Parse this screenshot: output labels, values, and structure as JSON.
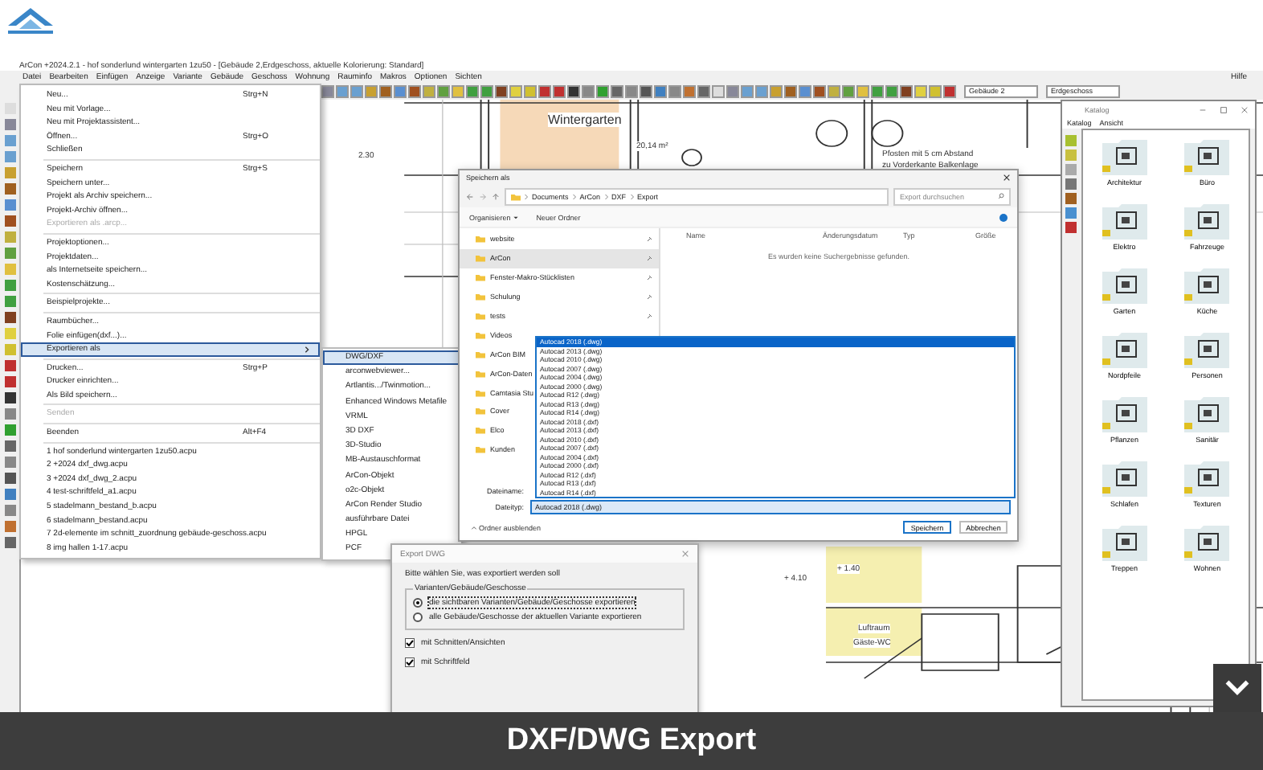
{
  "app": {
    "title": "ArCon +2024.2.1 - hof sonderlund wintergarten 1zu50 - [Gebäude 2,Erdgeschoss, aktuelle Kolorierung: Standard]",
    "menu": [
      "Datei",
      "Bearbeiten",
      "Einfügen",
      "Anzeige",
      "Variante",
      "Gebäude",
      "Geschoss",
      "Wohnung",
      "Rauminfo",
      "Makros",
      "Optionen",
      "Sichten"
    ],
    "help": "Hilfe",
    "building": "Gebäude 2",
    "floor": "Erdgeschoss"
  },
  "drawing": {
    "labels": [
      "Wintergarten",
      "20,14 m²",
      "Pfosten mit 5 cm Abstand",
      "zu Vorderkante Balkenlage",
      "2.30",
      "+ 1.40",
      "+ 4.10",
      "Luftraum",
      "Gäste-WC"
    ]
  },
  "file_menu": {
    "groups": [
      {
        "items": [
          {
            "label": "Neu...",
            "shortcut": "Strg+N",
            "kind": "item",
            "disabled": false,
            "selected": false
          },
          {
            "label": "Neu mit Vorlage...",
            "kind": "item",
            "disabled": false,
            "selected": false
          },
          {
            "label": "Neu mit Projektassistent...",
            "kind": "item",
            "disabled": false,
            "selected": false
          },
          {
            "label": "Öffnen...",
            "shortcut": "Strg+O",
            "kind": "item",
            "disabled": false,
            "selected": false
          },
          {
            "label": "Schließen",
            "kind": "item",
            "disabled": false,
            "selected": false
          }
        ]
      },
      {
        "items": [
          {
            "label": "Speichern",
            "shortcut": "Strg+S",
            "kind": "item",
            "disabled": false,
            "selected": false
          },
          {
            "label": "Speichern unter...",
            "kind": "item",
            "disabled": false,
            "selected": false
          },
          {
            "label": "Projekt als Archiv speichern...",
            "kind": "item",
            "disabled": false,
            "selected": false
          },
          {
            "label": "Projekt-Archiv öffnen...",
            "kind": "item",
            "disabled": false,
            "selected": false
          },
          {
            "label": "Exportieren als .arcp...",
            "kind": "item",
            "disabled": true,
            "selected": false
          }
        ]
      },
      {
        "items": [
          {
            "label": "Projektoptionen...",
            "kind": "item",
            "disabled": false,
            "selected": false
          },
          {
            "label": "Projektdaten...",
            "kind": "item",
            "disabled": false,
            "selected": false
          },
          {
            "label": "als Internetseite speichern...",
            "kind": "item",
            "disabled": false,
            "selected": false
          },
          {
            "label": "Kostenschätzung...",
            "kind": "item",
            "disabled": false,
            "selected": false
          }
        ]
      },
      {
        "items": [
          {
            "label": "Beispielprojekte...",
            "kind": "item",
            "disabled": false,
            "selected": false
          }
        ]
      },
      {
        "items": [
          {
            "label": "Raumbücher...",
            "kind": "item",
            "disabled": false,
            "selected": false
          },
          {
            "label": "Folie einfügen(dxf...)...",
            "kind": "item",
            "disabled": false,
            "selected": false
          },
          {
            "label": "Exportieren als",
            "kind": "submenu",
            "disabled": false,
            "selected": true
          }
        ]
      },
      {
        "items": [
          {
            "label": "Drucken...",
            "shortcut": "Strg+P",
            "kind": "item",
            "disabled": false,
            "selected": false
          },
          {
            "label": "Drucker einrichten...",
            "kind": "item",
            "disabled": false,
            "selected": false
          },
          {
            "label": "Als Bild speichern...",
            "kind": "item",
            "disabled": false,
            "selected": false
          }
        ]
      },
      {
        "items": [
          {
            "label": "Senden",
            "kind": "item",
            "disabled": true,
            "selected": false
          }
        ]
      },
      {
        "items": [
          {
            "label": "Beenden",
            "shortcut": "Alt+F4",
            "kind": "item",
            "disabled": false,
            "selected": false
          }
        ]
      },
      {
        "items": [
          {
            "label": "1 hof sonderlund wintergarten 1zu50.acpu",
            "kind": "item",
            "disabled": false,
            "selected": false
          },
          {
            "label": "2 +2024 dxf_dwg.acpu",
            "kind": "item",
            "disabled": false,
            "selected": false
          },
          {
            "label": "3 +2024 dxf_dwg_2.acpu",
            "kind": "item",
            "disabled": false,
            "selected": false
          },
          {
            "label": "4 test-schriftfeld_a1.acpu",
            "kind": "item",
            "disabled": false,
            "selected": false
          },
          {
            "label": "5 stadelmann_bestand_b.acpu",
            "kind": "item",
            "disabled": false,
            "selected": false
          },
          {
            "label": "6 stadelmann_bestand.acpu",
            "kind": "item",
            "disabled": false,
            "selected": false
          },
          {
            "label": "7 2d-elemente im schnitt_zuordnung gebäude-geschoss.acpu",
            "kind": "item",
            "disabled": false,
            "selected": false
          },
          {
            "label": "8 img hallen 1-17.acpu",
            "kind": "item",
            "disabled": false,
            "selected": false
          }
        ]
      }
    ]
  },
  "export_submenu": {
    "items": [
      {
        "label": "DWG/DXF",
        "selected": true
      },
      {
        "label": "arconwebviewer...",
        "selected": false
      },
      {
        "label": "Artlantis.../Twinmotion...",
        "selected": false
      },
      {
        "label": "Enhanced Windows Metafile",
        "selected": false
      },
      {
        "label": "VRML",
        "selected": false
      },
      {
        "label": "3D DXF",
        "selected": false
      },
      {
        "label": "3D-Studio",
        "selected": false
      },
      {
        "label": "MB-Austauschformat",
        "selected": false
      },
      {
        "label": "ArCon-Objekt",
        "selected": false
      },
      {
        "label": "o2c-Objekt",
        "selected": false
      },
      {
        "label": "ArCon Render Studio",
        "selected": false
      },
      {
        "label": "ausführbare Datei",
        "selected": false
      },
      {
        "label": "HPGL",
        "selected": false
      },
      {
        "label": "PCF",
        "selected": false
      }
    ]
  },
  "save_dialog": {
    "title": "Speichern als",
    "path": [
      "Documents",
      "ArCon",
      "DXF",
      "Export"
    ],
    "search_placeholder": "Export durchsuchen",
    "organize": "Organisieren",
    "new_folder": "Neuer Ordner",
    "folders": [
      {
        "label": "website",
        "pinned": true,
        "selected": false
      },
      {
        "label": "ArCon",
        "pinned": true,
        "selected": true
      },
      {
        "label": "Fenster-Makro-Stücklisten",
        "pinned": true,
        "selected": false
      },
      {
        "label": "Schulung",
        "pinned": true,
        "selected": false
      },
      {
        "label": "tests",
        "pinned": true,
        "selected": false
      },
      {
        "label": "Videos",
        "selected": false
      },
      {
        "label": "ArCon BIM",
        "selected": false
      },
      {
        "label": "ArCon-Daten",
        "selected": false
      },
      {
        "label": "Camtasia Stu",
        "selected": false
      },
      {
        "label": "Cover",
        "selected": false
      },
      {
        "label": "Elco",
        "selected": false
      },
      {
        "label": "Kunden",
        "selected": false
      }
    ],
    "columns": [
      "Name",
      "Änderungsdatum",
      "Typ",
      "Größe"
    ],
    "empty_message": "Es wurden keine Suchergebnisse gefunden.",
    "filename_label": "Dateiname:",
    "filetype_label": "Dateityp:",
    "filetype_value": "Autocad 2018 (.dwg)",
    "filetype_options": [
      {
        "label": "Autocad 2018 (.dwg)",
        "selected": true
      },
      {
        "label": "Autocad 2013 (.dwg)",
        "selected": false
      },
      {
        "label": "Autocad 2010 (.dwg)",
        "selected": false
      },
      {
        "label": "Autocad 2007 (.dwg)",
        "selected": false
      },
      {
        "label": "Autocad 2004 (.dwg)",
        "selected": false
      },
      {
        "label": "Autocad 2000 (.dwg)",
        "selected": false
      },
      {
        "label": "Autocad R12 (.dwg)",
        "selected": false
      },
      {
        "label": "Autocad R13 (.dwg)",
        "selected": false
      },
      {
        "label": "Autocad R14 (.dwg)",
        "selected": false
      },
      {
        "label": "Autocad 2018 (.dxf)",
        "selected": false
      },
      {
        "label": "Autocad 2013 (.dxf)",
        "selected": false
      },
      {
        "label": "Autocad 2010 (.dxf)",
        "selected": false
      },
      {
        "label": "Autocad 2007 (.dxf)",
        "selected": false
      },
      {
        "label": "Autocad 2004 (.dxf)",
        "selected": false
      },
      {
        "label": "Autocad 2000 (.dxf)",
        "selected": false
      },
      {
        "label": "Autocad R12 (.dxf)",
        "selected": false
      },
      {
        "label": "Autocad R13 (.dxf)",
        "selected": false
      },
      {
        "label": "Autocad R14 (.dxf)",
        "selected": false
      }
    ],
    "hide_folders": "Ordner ausblenden",
    "save": "Speichern",
    "cancel": "Abbrechen"
  },
  "export_dialog": {
    "title": "Export DWG",
    "prompt": "Bitte wählen Sie, was exportiert werden soll",
    "group": "Varianten/Gebäude/Geschosse",
    "options": [
      {
        "label": "die sichtbaren Varianten/Gebäude/Geschosse exportieren",
        "selected": true
      },
      {
        "label": "alle Gebäude/Geschosse der aktuellen Variante exportieren",
        "selected": false
      }
    ],
    "checks": [
      {
        "label": "mit Schnitten/Ansichten",
        "checked": true
      },
      {
        "label": "mit Schriftfeld",
        "checked": true
      }
    ]
  },
  "catalog": {
    "title": "Katalog",
    "menu": [
      "Katalog",
      "Ansicht"
    ],
    "items": [
      "Architektur",
      "Büro",
      "Elektro",
      "Fahrzeuge",
      "Garten",
      "Küche",
      "Nordpfeile",
      "Personen",
      "Pflanzen",
      "Sanitär",
      "Schlafen",
      "Texturen",
      "Treppen",
      "Wohnen"
    ]
  },
  "caption": "DXF/DWG Export"
}
